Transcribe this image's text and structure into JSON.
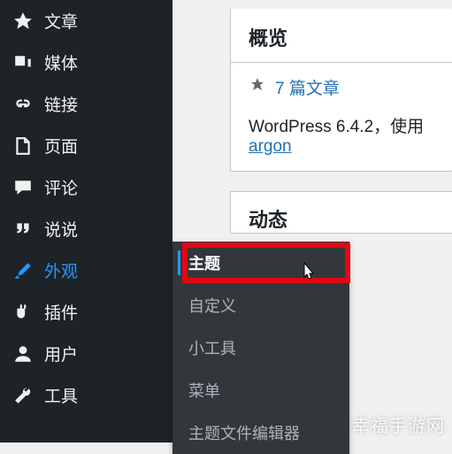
{
  "sidebar": {
    "items": [
      {
        "label": "文章",
        "icon": "pin"
      },
      {
        "label": "媒体",
        "icon": "media"
      },
      {
        "label": "链接",
        "icon": "link"
      },
      {
        "label": "页面",
        "icon": "page"
      },
      {
        "label": "评论",
        "icon": "comment"
      },
      {
        "label": "说说",
        "icon": "quote"
      },
      {
        "label": "外观",
        "icon": "brush"
      },
      {
        "label": "插件",
        "icon": "plugin"
      },
      {
        "label": "用户",
        "icon": "user"
      },
      {
        "label": "工具",
        "icon": "tool"
      }
    ]
  },
  "submenu": {
    "items": [
      {
        "label": "主题"
      },
      {
        "label": "自定义"
      },
      {
        "label": "小工具"
      },
      {
        "label": "菜单"
      },
      {
        "label": "主题文件编辑器"
      }
    ]
  },
  "overview": {
    "heading": "概览",
    "posts_link": "7 篇文章",
    "meta_prefix": "WordPress 6.4.2，使用 ",
    "theme_link": "argon"
  },
  "activity": {
    "heading": "动态"
  },
  "watermark": "幸福手游网"
}
